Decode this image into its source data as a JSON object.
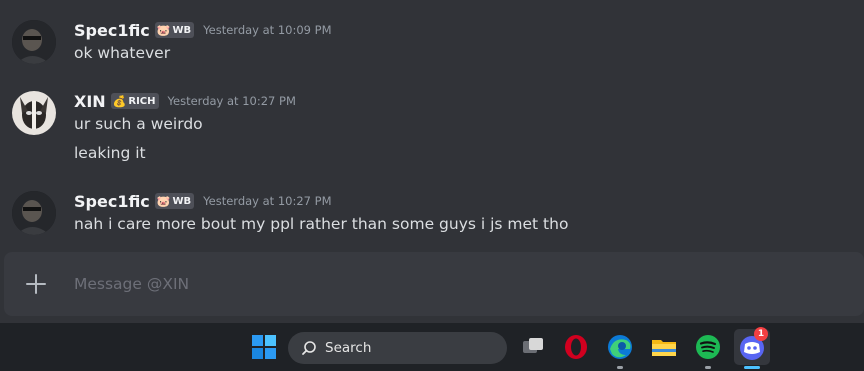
{
  "messages": [
    {
      "username": "Spec1fic",
      "tag_emoji": "🐷",
      "tag_text": "WB",
      "timestamp": "Yesterday at 10:09 PM",
      "lines": [
        "ok whatever"
      ]
    },
    {
      "username": "XIN",
      "tag_emoji": "💰",
      "tag_text": "RICH",
      "timestamp": "Yesterday at 10:27 PM",
      "lines": [
        "ur such a weirdo",
        "leaking it"
      ]
    },
    {
      "username": "Spec1fic",
      "tag_emoji": "🐷",
      "tag_text": "WB",
      "timestamp": "Yesterday at 10:27 PM",
      "lines": [
        "nah i care more bout my ppl rather than some guys i js met tho"
      ]
    }
  ],
  "composer": {
    "placeholder": "Message @XIN",
    "plus_icon": "plus-circle-icon"
  },
  "taskbar": {
    "search_label": "Search",
    "icons": [
      "windows-start-icon",
      "search-icon",
      "task-view-icon",
      "opera-icon",
      "edge-icon",
      "file-explorer-icon",
      "spotify-icon",
      "discord-icon"
    ],
    "discord_badge": "1",
    "colors": {
      "windows_blue": "#2b9af3",
      "opera_red": "#d1001f",
      "spotify_green": "#1db954",
      "discord_blurple": "#5865f2",
      "badge_red": "#f23f42"
    }
  }
}
